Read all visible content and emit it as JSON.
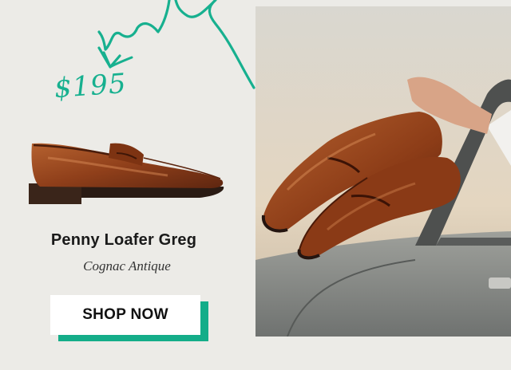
{
  "price": "$195",
  "product": {
    "name": "Penny Loafer Greg",
    "color": "Cognac Antique"
  },
  "cta": {
    "label": "SHOP NOW"
  },
  "colors": {
    "background": "#ecebe7",
    "accent": "#14ad89",
    "leather": "#9a4a22"
  },
  "icons": [
    "scribble-arrow-icon"
  ]
}
